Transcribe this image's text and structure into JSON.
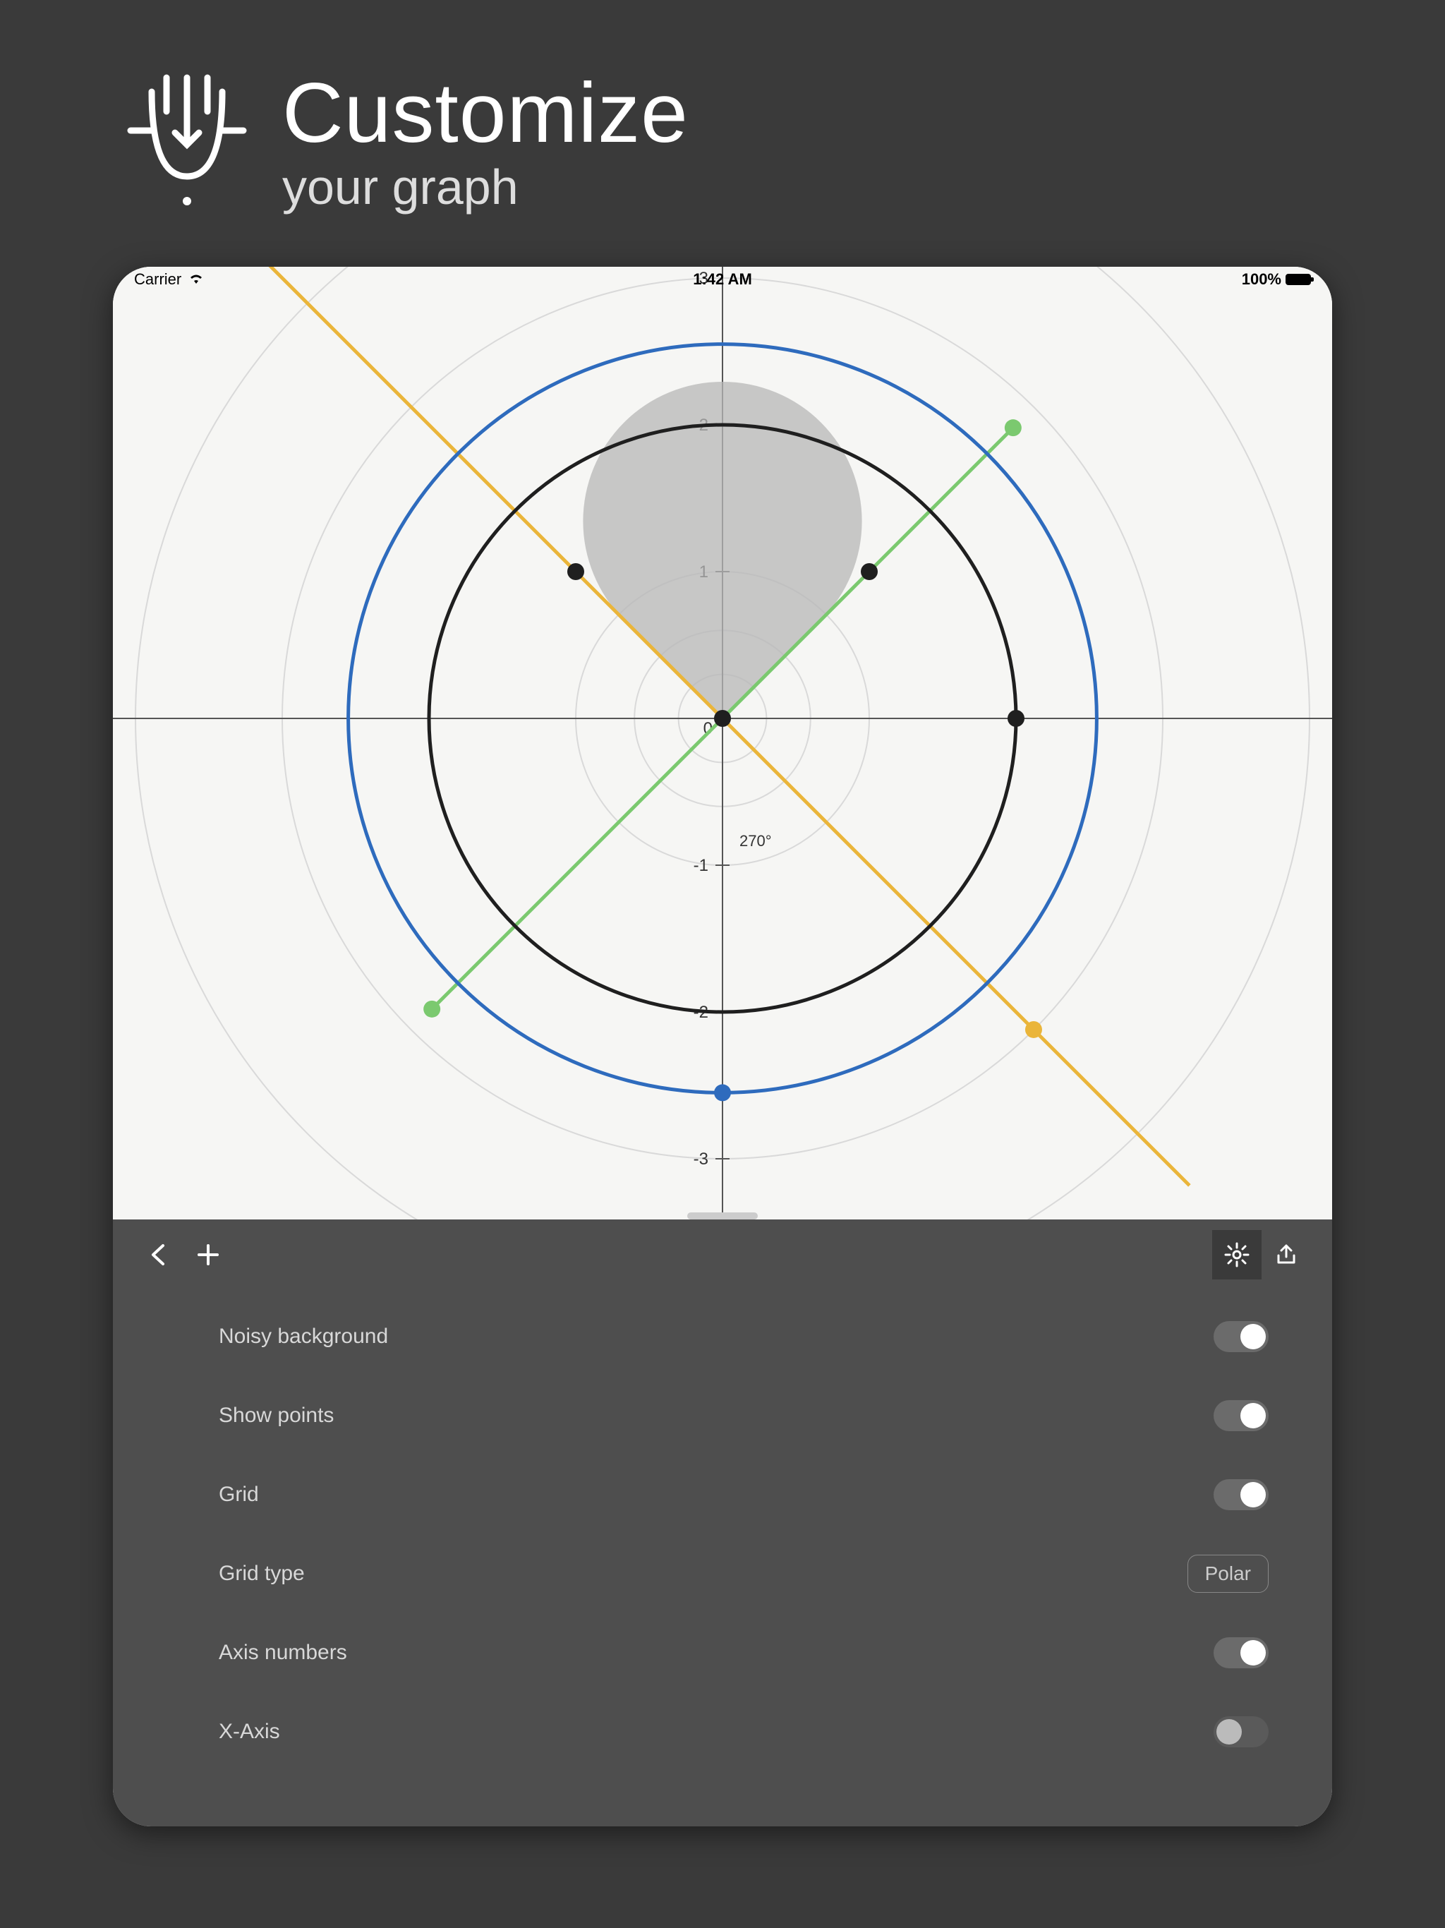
{
  "header": {
    "title": "Customize",
    "subtitle": "your graph"
  },
  "status_bar": {
    "carrier": "Carrier",
    "time": "1:42 AM",
    "battery_pct": "100%"
  },
  "chart_data": {
    "type": "polar",
    "center_label": "0",
    "radial_ticks_positive": [
      "1",
      "2"
    ],
    "radial_ticks_negative": [
      "-1",
      "-2",
      "-3"
    ],
    "hidden_upper_tick": "3",
    "angle_label": "270°",
    "grid_circles_radii_units": [
      0.3,
      0.6,
      1,
      2,
      3,
      4
    ],
    "shapes": [
      {
        "kind": "circle",
        "color": "#1f1f1f",
        "radius_units": 2.0
      },
      {
        "kind": "circle",
        "color": "#2e6bbd",
        "radius_units": 2.55,
        "endpoint_angle_deg": 270
      },
      {
        "kind": "line",
        "color": "#eab53a",
        "angle_deg": -45,
        "endpoints_r_units": [
          -4.5,
          4.5
        ],
        "endpoint_mark_r_units": 3.0
      },
      {
        "kind": "line",
        "color": "#7bc96f",
        "angle_deg": 45,
        "endpoints_r_units": [
          -2.8,
          2.8
        ]
      },
      {
        "kind": "pie_slice",
        "color": "#b7b7b7",
        "radius_units": 0.95,
        "start_deg": 135,
        "end_deg": 405
      }
    ],
    "points": [
      {
        "x_units": -1.0,
        "y_units": 1.0,
        "color": "#1f1f1f"
      },
      {
        "x_units": 1.0,
        "y_units": 1.0,
        "color": "#1f1f1f"
      },
      {
        "x_units": 0.0,
        "y_units": 0.0,
        "color": "#1f1f1f"
      },
      {
        "x_units": 2.0,
        "y_units": 0.0,
        "color": "#1f1f1f"
      },
      {
        "x_units": -1.98,
        "y_units": -1.98,
        "color": "#7bc96f"
      },
      {
        "x_units": 1.98,
        "y_units": 1.98,
        "color": "#7bc96f"
      },
      {
        "x_units": 2.12,
        "y_units": -2.12,
        "color": "#eab53a"
      },
      {
        "x_units": 0.0,
        "y_units": -2.55,
        "color": "#2e6bbd"
      }
    ]
  },
  "settings": {
    "items": [
      {
        "label": "Noisy background",
        "type": "toggle",
        "value": true
      },
      {
        "label": "Show points",
        "type": "toggle",
        "value": true
      },
      {
        "label": "Grid",
        "type": "toggle",
        "value": true
      },
      {
        "label": "Grid type",
        "type": "select",
        "value": "Polar"
      },
      {
        "label": "Axis numbers",
        "type": "toggle",
        "value": true
      },
      {
        "label": "X-Axis",
        "type": "toggle",
        "value": false
      }
    ]
  }
}
